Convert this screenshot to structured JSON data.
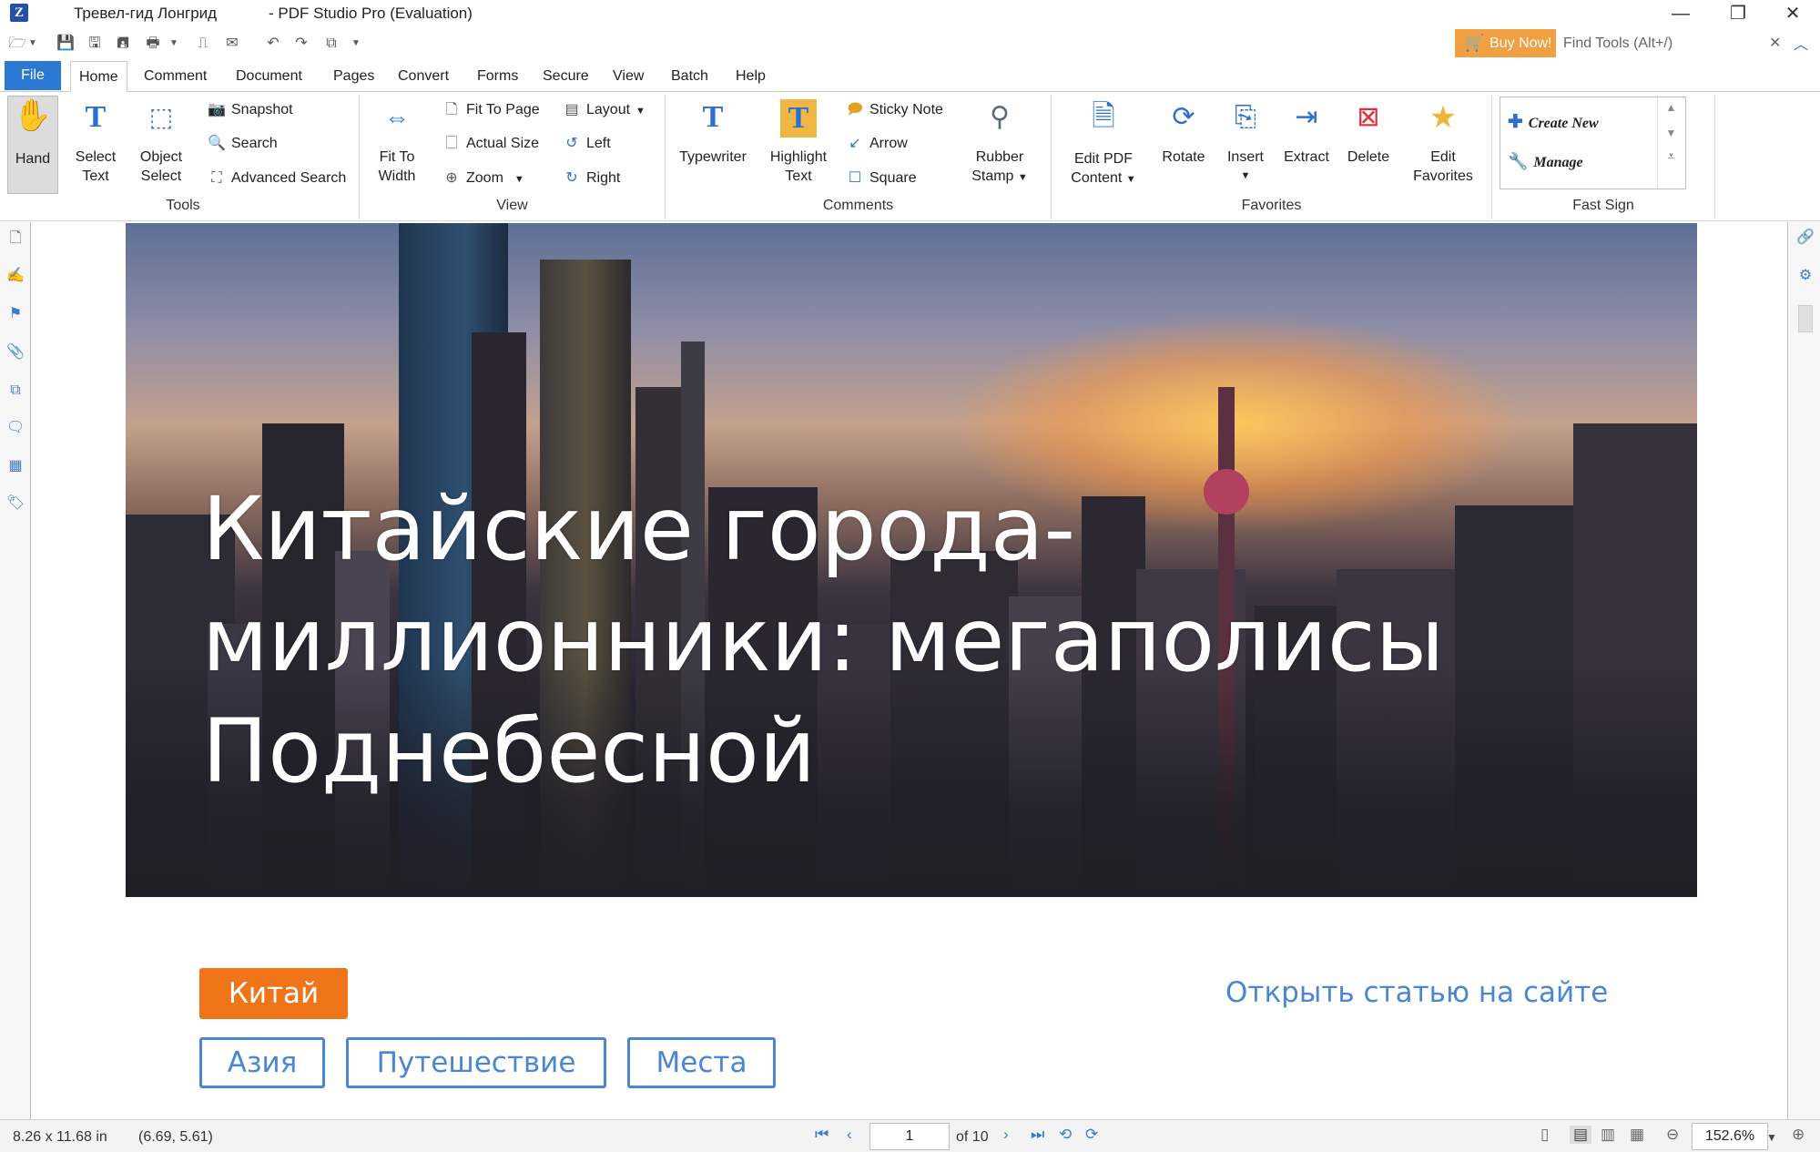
{
  "window": {
    "document_title": "Тревел-гид Лонгрид",
    "app_title": "- PDF Studio Pro (Evaluation)",
    "minimize": "—",
    "restore": "❐",
    "close": "✕"
  },
  "quickbar": {
    "buy_now": "Buy Now!",
    "find_tools_placeholder": "Find Tools  (Alt+/)",
    "find_close": "✕",
    "collapse": "︿"
  },
  "menu": {
    "file": "File",
    "tabs": [
      "Home",
      "Comment",
      "Document",
      "Pages",
      "Convert",
      "Forms",
      "Secure",
      "View",
      "Batch",
      "Help"
    ]
  },
  "ribbon": {
    "tools": {
      "hand": "Hand",
      "select_text_1": "Select",
      "select_text_2": "Text",
      "object_select_1": "Object",
      "object_select_2": "Select",
      "snapshot": "Snapshot",
      "search": "Search",
      "advanced_search": "Advanced Search",
      "group": "Tools"
    },
    "view": {
      "fit_width_1": "Fit To",
      "fit_width_2": "Width",
      "fit_page": "Fit To Page",
      "actual_size": "Actual Size",
      "zoom": "Zoom",
      "layout": "Layout",
      "left": "Left",
      "right": "Right",
      "group": "View"
    },
    "comments": {
      "typewriter": "Typewriter",
      "highlight_1": "Highlight",
      "highlight_2": "Text",
      "sticky_note": "Sticky Note",
      "arrow": "Arrow",
      "square": "Square",
      "rubber_1": "Rubber",
      "rubber_2": "Stamp",
      "group": "Comments"
    },
    "favorites": {
      "edit_pdf_1": "Edit PDF",
      "edit_pdf_2": "Content",
      "rotate": "Rotate",
      "insert": "Insert",
      "extract": "Extract",
      "delete": "Delete",
      "edit_fav_1": "Edit",
      "edit_fav_2": "Favorites",
      "group": "Favorites"
    },
    "fastsign": {
      "create_new": "Create New",
      "manage": "Manage",
      "group": "Fast Sign"
    }
  },
  "document": {
    "hero_title": "Китайские города-миллионники: мегаполисы Поднебесной",
    "main_tag": "Китай",
    "tags": [
      "Азия",
      "Путешествие",
      "Места"
    ],
    "open_link": "Открыть статью на сайте"
  },
  "status": {
    "page_size": "8.26 x 11.68 in",
    "cursor": "(6.69, 5.61)",
    "page_current": "1",
    "page_total": "of 10",
    "zoom": "152.6%"
  },
  "colors": {
    "accent": "#2c79d3",
    "buy_now": "#f0a040",
    "tag_main": "#f07519",
    "tag_outline": "#4a86d4"
  }
}
